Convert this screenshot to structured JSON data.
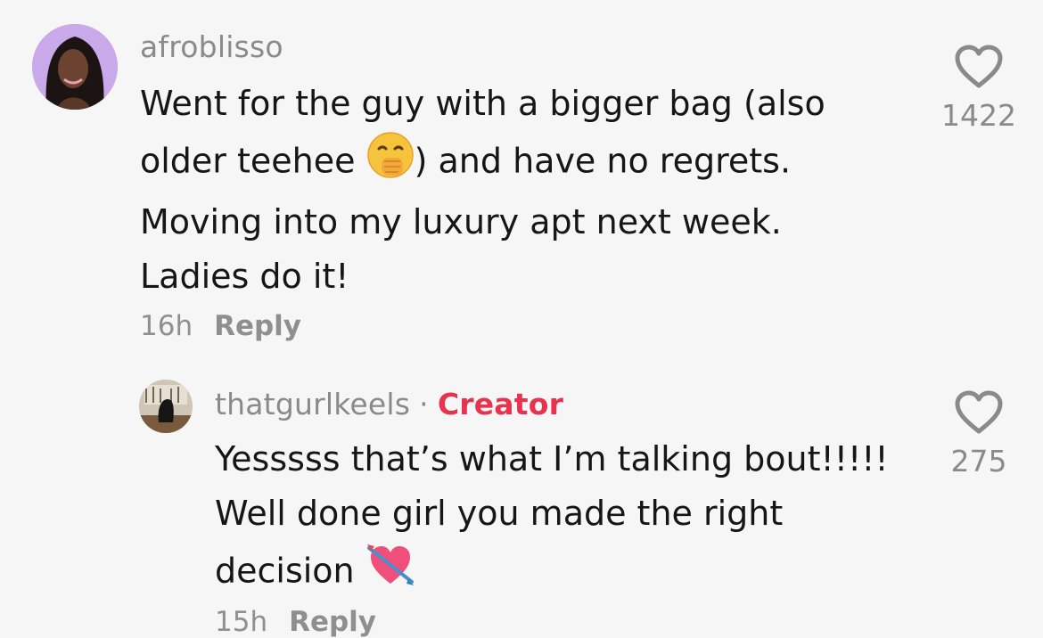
{
  "comment": {
    "username": "afroblisso",
    "lines": [
      "Went for the guy with a bigger bag (also",
      "older teehee ",
      ") and have no regrets.",
      "Moving into my luxury apt next week.",
      "Ladies do it!"
    ],
    "emoji": "face-with-hand-over-mouth-emoji",
    "time": "16h",
    "reply_label": "Reply",
    "likes": "1422"
  },
  "reply": {
    "username": "thatgurlkeels",
    "separator": "·",
    "badge": "Creator",
    "lines": [
      "Yesssss that’s what I’m talking bout!!!!!",
      "Well done girl you made the right",
      "decision "
    ],
    "emoji": "heart-with-arrow-emoji",
    "time": "15h",
    "reply_label": "Reply",
    "likes": "275"
  },
  "colors": {
    "background": "#f6f6f6",
    "creator": "#e8324e",
    "muted": "#8a8a8a",
    "text": "#161616"
  }
}
